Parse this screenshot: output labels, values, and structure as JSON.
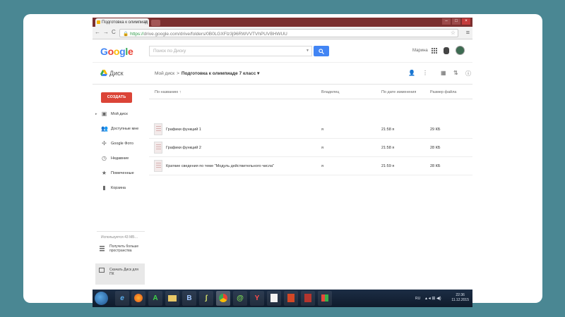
{
  "browser": {
    "tab_title": "Подготовка к олимпиад",
    "tab_close": "×",
    "window_controls": [
      "–",
      "□",
      "×"
    ],
    "url_scheme": "https://",
    "url_rest": "drive.google.com/drive/folders/0B0LGXFlz3j96RWVVTVhPUVBHWUU",
    "nav": [
      "←",
      "→",
      "C"
    ]
  },
  "header": {
    "logo": "Google",
    "search_placeholder": "Поиск по Диску",
    "user_name": "Марина"
  },
  "toolbar": {
    "brand": "Диск",
    "crumb_root": "Мой диск",
    "crumb_sep": ">",
    "crumb_current": "Подготовка к олимпиаде 7 класс ▾"
  },
  "sidebar": {
    "create_label": "СОЗДАТЬ",
    "items": [
      {
        "label": "Мой диск",
        "icon": "drive-folder-icon"
      },
      {
        "label": "Доступные мне",
        "icon": "people-icon"
      },
      {
        "label": "Google Фото",
        "icon": "photos-icon"
      },
      {
        "label": "Недавние",
        "icon": "clock-icon"
      },
      {
        "label": "Помеченные",
        "icon": "star-icon"
      },
      {
        "label": "Корзина",
        "icon": "trash-icon"
      }
    ],
    "usage": "Используется 43 МБ…",
    "get_more": "Получить больше пространства",
    "download": "Скачать Диск для ПК"
  },
  "files": {
    "columns": {
      "name": "По названию ↑",
      "owner": "Владелец",
      "modified": "По дате изменения",
      "size": "Размер файла"
    },
    "rows": [
      {
        "name": "Графики функций 1",
        "owner": "я",
        "modified": "21:58 я",
        "size": "29 КБ"
      },
      {
        "name": "Графики функций 2",
        "owner": "я",
        "modified": "21:58 я",
        "size": "28 КБ"
      },
      {
        "name": "Краткие сведения по теме \"Модуль действительного числа\"",
        "owner": "я",
        "modified": "21:59 я",
        "size": "28 КБ"
      }
    ]
  },
  "taskbar": {
    "apps": [
      "IE",
      "Firefox",
      "A",
      "Explorer",
      "B",
      "Sketch",
      "Chrome",
      "Messenger",
      "Yandex",
      "Docs",
      "PowerPoint",
      "Archive",
      "Windows"
    ],
    "lang": "RU",
    "time": "22:36",
    "date": "11.12.2015"
  },
  "colors": {
    "background": "#4a8793",
    "create_button": "#db4437",
    "search_button": "#4285f4",
    "tabbar": "#7b2f2f"
  }
}
